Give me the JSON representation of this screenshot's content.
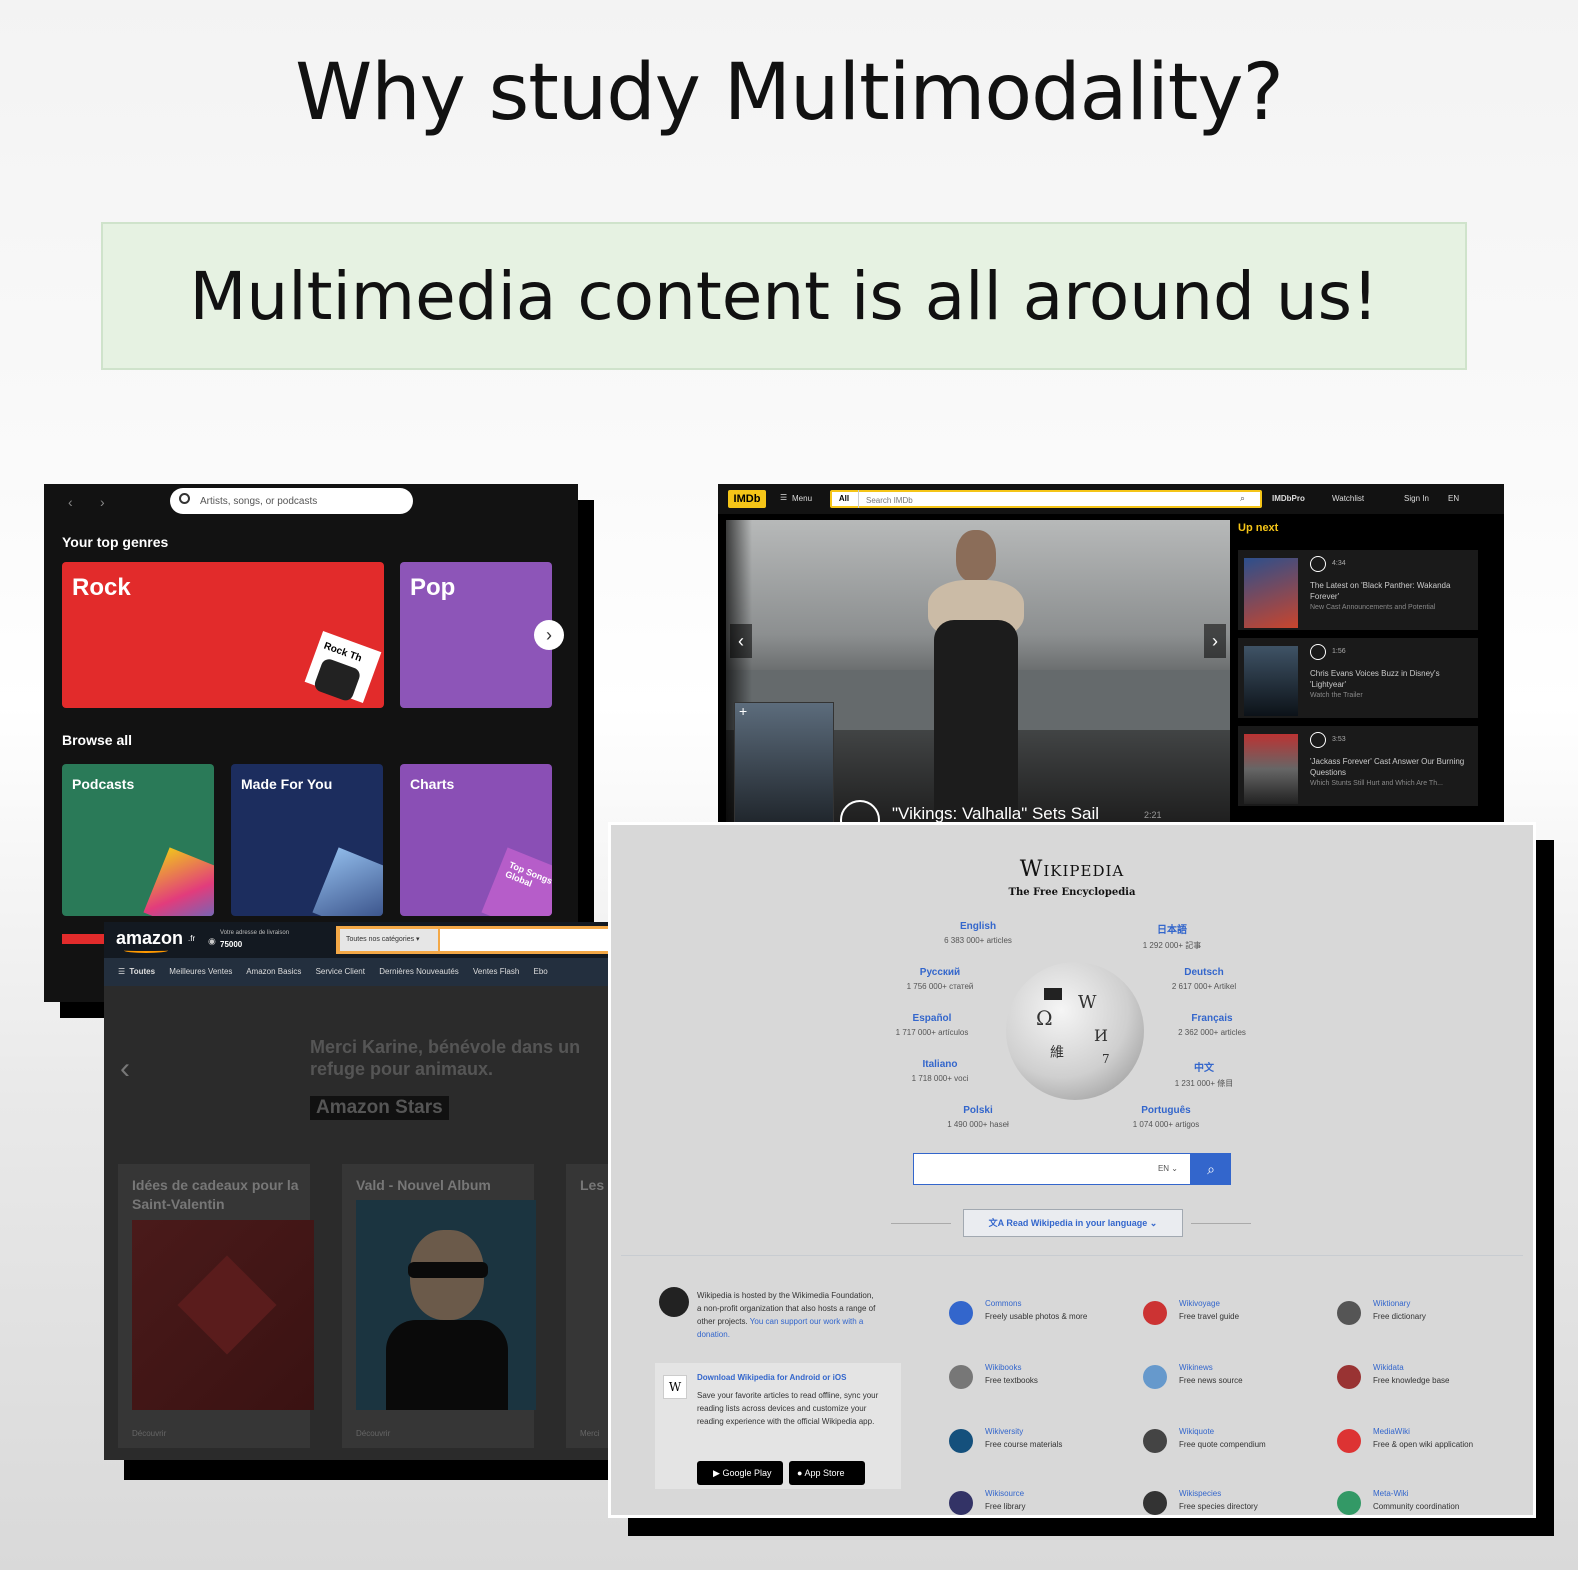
{
  "slide": {
    "title": "Why study Multimodality?",
    "callout": "Multimedia content is all around us!"
  },
  "spotify": {
    "search_placeholder": "Artists, songs, or podcasts",
    "top_genres_heading": "Your top genres",
    "browse_heading": "Browse all",
    "genres": [
      {
        "label": "Rock",
        "color": "#e13300"
      },
      {
        "label": "Pop",
        "color": "#8d67ab"
      }
    ],
    "browse": [
      {
        "label": "Podcasts",
        "color": "#27856a"
      },
      {
        "label": "Made For You",
        "color": "#1e3264"
      },
      {
        "label": "Charts",
        "color": "#8d67ab"
      }
    ],
    "rock_art_text": "Rock Th",
    "charts_art_text": "Top Songs Global"
  },
  "imdb": {
    "logo": "IMDb",
    "menu": "Menu",
    "all": "All",
    "search_placeholder": "Search IMDb",
    "imdbpro": "IMDbPro",
    "watchlist": "Watchlist",
    "signin": "Sign In",
    "lang": "EN",
    "up_next": "Up next",
    "hero_caption": "\"Vikings: Valhalla\" Sets Sail",
    "hero_duration": "2:21",
    "upnext": [
      {
        "duration": "4:34",
        "title": "The Latest on 'Black Panther: Wakanda Forever'",
        "sub": "New Cast Announcements and Potential"
      },
      {
        "duration": "1:56",
        "title": "Chris Evans Voices Buzz in Disney's 'Lightyear'",
        "sub": "Watch the Trailer"
      },
      {
        "duration": "3:53",
        "title": "'Jackass Forever' Cast Answer Our Burning Questions",
        "sub": "Which Stunts Still Hurt and Which Are Th..."
      }
    ],
    "accent": "#f5c518"
  },
  "amazon": {
    "logo": "amazon",
    "logo_suffix": ".fr",
    "deliver_line1": "Votre adresse de livraison",
    "deliver_line2": "75000",
    "search_category": "Toutes nos catégories",
    "nav": [
      "Toutes",
      "Meilleures Ventes",
      "Amazon Basics",
      "Service Client",
      "Dernières Nouveautés",
      "Ventes Flash",
      "Ebo"
    ],
    "hero_text": "Merci Karine, bénévole dans un refuge pour animaux.",
    "hero_badge": "Amazon Stars",
    "cards": [
      {
        "title": "Idées de cadeaux pour la Saint-Valentin",
        "more": "Découvrir"
      },
      {
        "title": "Vald - Nouvel Album",
        "more": "Découvrir"
      },
      {
        "title": "Les",
        "more": "Merci"
      }
    ]
  },
  "wikipedia": {
    "wordmark": "Wikipedia",
    "tagline": "The Free Encyclopedia",
    "languages": [
      {
        "lang": "English",
        "count": "6 383 000+ articles"
      },
      {
        "lang": "日本語",
        "count": "1 292 000+ 記事"
      },
      {
        "lang": "Русский",
        "count": "1 756 000+ статей"
      },
      {
        "lang": "Deutsch",
        "count": "2 617 000+ Artikel"
      },
      {
        "lang": "Español",
        "count": "1 717 000+ artículos"
      },
      {
        "lang": "Français",
        "count": "2 362 000+ articles"
      },
      {
        "lang": "Italiano",
        "count": "1 718 000+ voci"
      },
      {
        "lang": "中文",
        "count": "1 231 000+ 條目"
      },
      {
        "lang": "Polski",
        "count": "1 490 000+ haseł"
      },
      {
        "lang": "Português",
        "count": "1 074 000+ artigos"
      }
    ],
    "search_lang": "EN",
    "read_language_button": "Read Wikipedia in your language",
    "footer_text": "Wikipedia is hosted by the Wikimedia Foundation, a non-profit organization that also hosts a range of other projects.",
    "footer_link": "You can support our work with a donation.",
    "download_title": "Download Wikipedia for Android or iOS",
    "download_text": "Save your favorite articles to read offline, sync your reading lists across devices and customize your reading experience with the official Wikipedia app.",
    "google_play": "Google Play",
    "app_store": "App Store",
    "sister_projects": [
      {
        "name": "Commons",
        "desc": "Freely usable photos & more",
        "color": "#36c"
      },
      {
        "name": "Wikivoyage",
        "desc": "Free travel guide",
        "color": "#c33"
      },
      {
        "name": "Wiktionary",
        "desc": "Free dictionary",
        "color": "#555"
      },
      {
        "name": "Wikibooks",
        "desc": "Free textbooks",
        "color": "#777"
      },
      {
        "name": "Wikinews",
        "desc": "Free news source",
        "color": "#69c"
      },
      {
        "name": "Wikidata",
        "desc": "Free knowledge base",
        "color": "#933"
      },
      {
        "name": "Wikiversity",
        "desc": "Free course materials",
        "color": "#14507c"
      },
      {
        "name": "Wikiquote",
        "desc": "Free quote compendium",
        "color": "#444"
      },
      {
        "name": "MediaWiki",
        "desc": "Free & open wiki application",
        "color": "#d33"
      },
      {
        "name": "Wikisource",
        "desc": "Free library",
        "color": "#336"
      },
      {
        "name": "Wikispecies",
        "desc": "Free species directory",
        "color": "#333"
      },
      {
        "name": "Meta-Wiki",
        "desc": "Community coordination",
        "color": "#396"
      }
    ]
  }
}
